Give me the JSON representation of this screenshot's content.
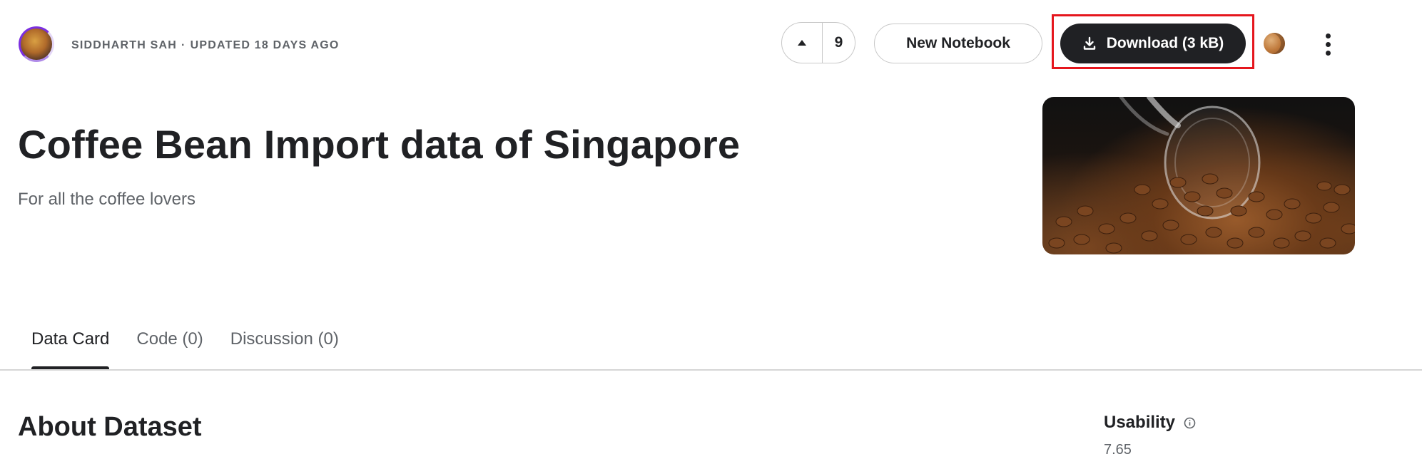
{
  "header": {
    "author": "SIDDHARTH SAH",
    "separator": "·",
    "updated": "UPDATED 18 DAYS AGO",
    "upvote_count": "9",
    "new_notebook_label": "New Notebook",
    "download_label": "Download (3 kB)"
  },
  "dataset": {
    "title": "Coffee Bean Import data of Singapore",
    "subtitle": "For all the coffee lovers"
  },
  "tabs": [
    {
      "label": "Data Card",
      "active": true
    },
    {
      "label": "Code (0)",
      "active": false
    },
    {
      "label": "Discussion (0)",
      "active": false
    }
  ],
  "content": {
    "section_heading": "About Dataset"
  },
  "sidebar": {
    "usability_label": "Usability",
    "usability_value": "7.65"
  },
  "icons": {
    "upvote": "caret-up-icon",
    "download": "download-icon",
    "more": "more-vertical-icon",
    "info": "info-icon"
  },
  "colors": {
    "primary_button": "#202124",
    "highlight_box": "#e5161d",
    "avatar_ring": "#7b2fe0",
    "muted_text": "#5f6368"
  }
}
